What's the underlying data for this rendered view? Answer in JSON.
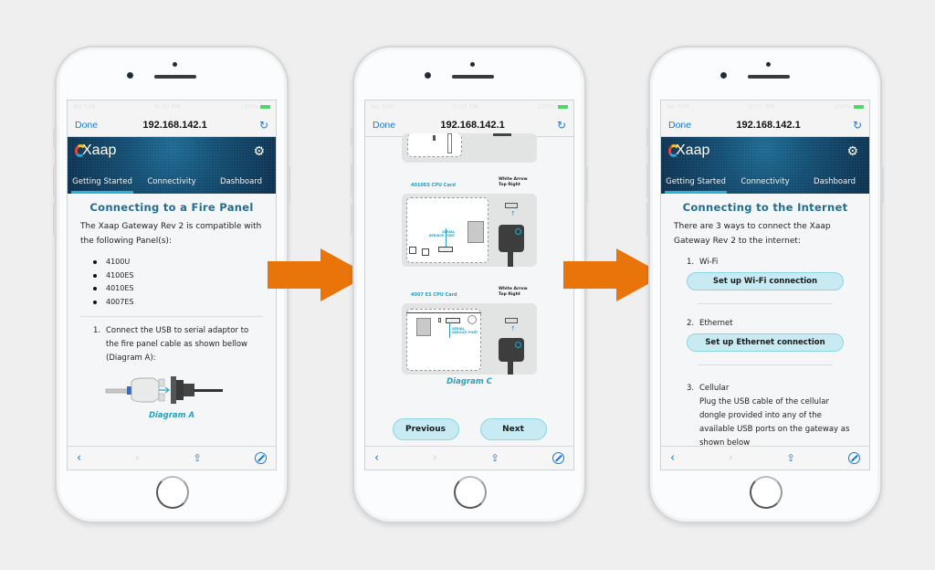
{
  "status_bar": {
    "carrier": "No SIM",
    "time": "5:10 PM",
    "battery": "100%"
  },
  "browser": {
    "done_label": "Done",
    "url": "192.168.142.1"
  },
  "app": {
    "logo": "Xaap",
    "tabs": [
      {
        "label": "Getting Started",
        "active": true
      },
      {
        "label": "Connectivity",
        "active": false
      },
      {
        "label": "Dashboard",
        "active": false
      }
    ]
  },
  "screen1": {
    "title": "Connecting to a Fire Panel",
    "intro": "The Xaap Gateway Rev 2 is compatible with the following Panel(s):",
    "panels": [
      "4100U",
      "4100ES",
      "4010ES",
      "4007ES"
    ],
    "step1_num": "1.",
    "step1_text": "Connect the USB to serial adaptor to the fire panel cable as shown bellow (Diagram A):",
    "diagram_caption": "Diagram A"
  },
  "screen2": {
    "card1_label": "4010ES CPU Card",
    "card1_note": "White Arrow Top Right",
    "card1_port_label": "SERIAL SERVICE PORT",
    "card2_label": "4007 ES CPU Card",
    "card2_note": "White Arrow Top Right",
    "card2_port_label": "SERIAL SERVICE PORT",
    "diagram_caption": "Diagram C",
    "previous_label": "Previous",
    "next_label": "Next"
  },
  "screen3": {
    "title": "Connecting to the Internet",
    "intro": "There are 3 ways to connect the Xaap Gateway Rev 2 to the internet:",
    "options": [
      {
        "num": "1.",
        "label": "Wi-Fi",
        "button": "Set up Wi-Fi connection"
      },
      {
        "num": "2.",
        "label": "Ethernet",
        "button": "Set up Ethernet connection"
      },
      {
        "num": "3.",
        "label": "Cellular",
        "description": "Plug the USB cable of the cellular dongle provided into any of the available USB ports on the gateway as shown below"
      }
    ]
  },
  "colors": {
    "accent": "#1d6f96",
    "link": "#1a7ad9",
    "arrow": "#e9750a",
    "button_fill": "#c7eaf3"
  }
}
